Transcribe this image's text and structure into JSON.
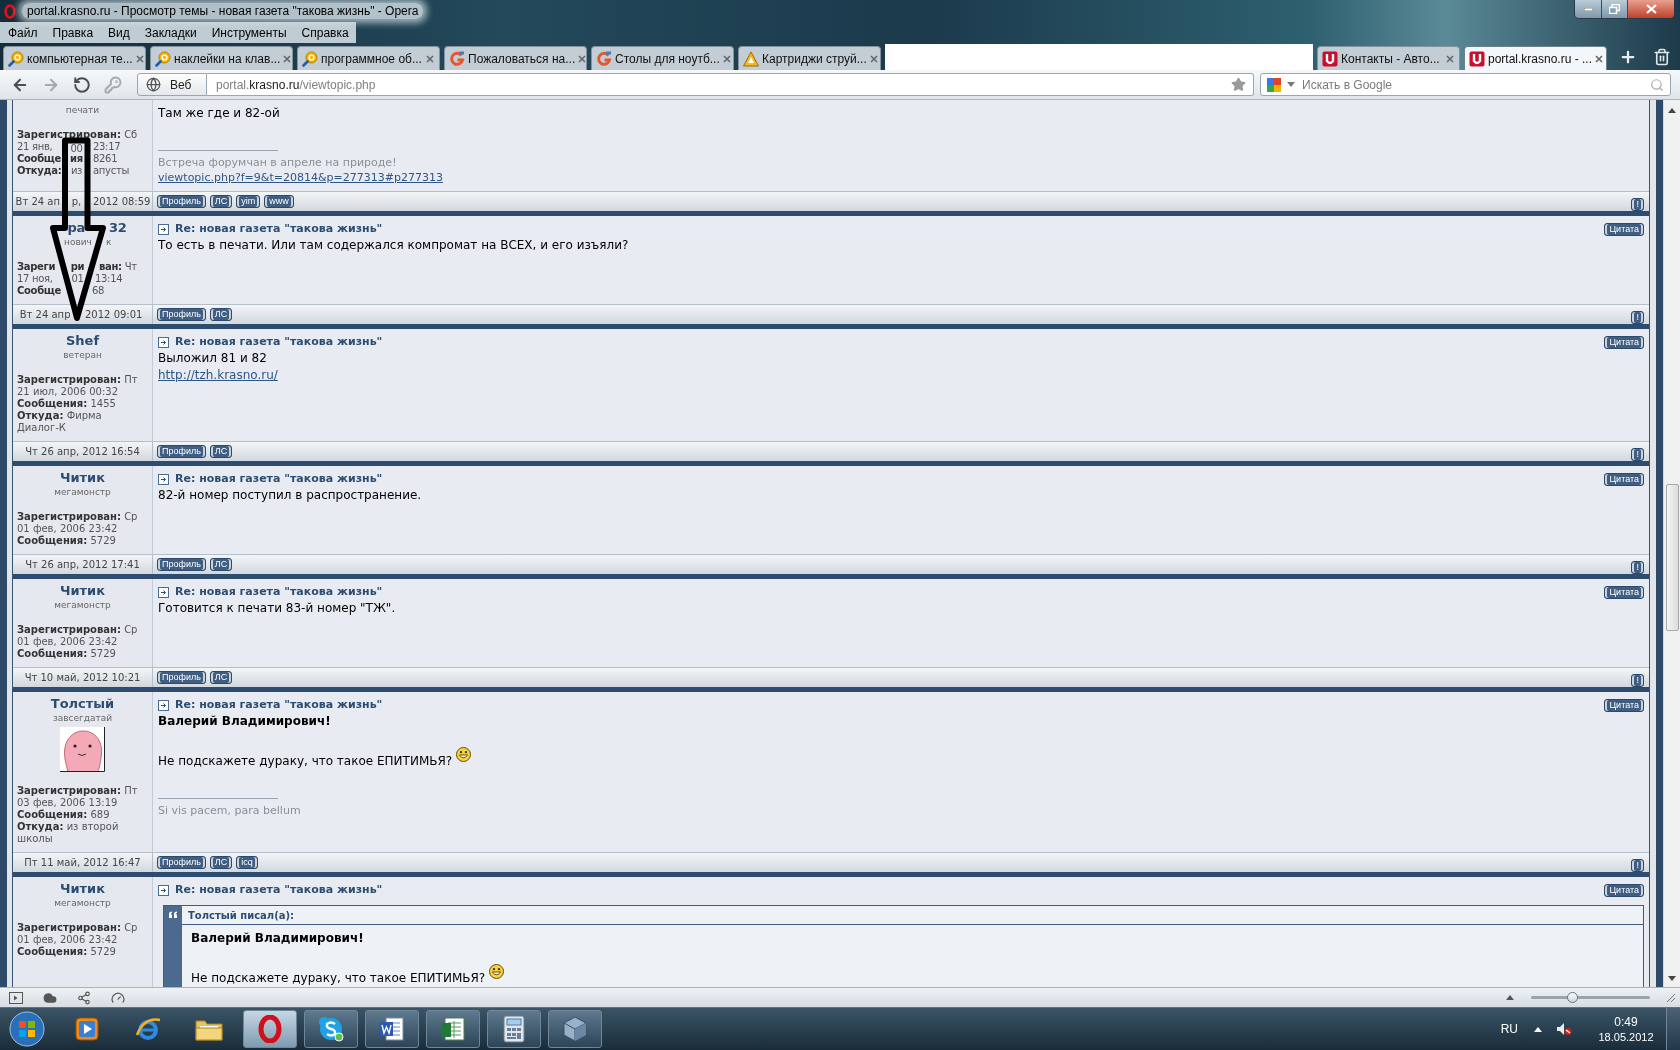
{
  "window": {
    "title": "portal.krasno.ru - Просмотр темы - новая газета \"такова жизнь\" - Opera"
  },
  "menu": [
    "Файл",
    "Правка",
    "Вид",
    "Закладки",
    "Инструменты",
    "Справка"
  ],
  "tabs": [
    {
      "kind": "magnifier",
      "label": "компьютерная те...",
      "selected": false
    },
    {
      "kind": "magnifier",
      "label": "наклейки на клав...",
      "selected": false
    },
    {
      "kind": "magnifier",
      "label": "программное об...",
      "selected": false
    },
    {
      "kind": "gletter",
      "label": "Пожаловаться на...",
      "selected": false
    },
    {
      "kind": "gletter",
      "label": "Столы для ноутб...",
      "selected": false
    },
    {
      "kind": "triangle",
      "label": "Картриджи струй...",
      "selected": false
    },
    {
      "kind": "cover"
    },
    {
      "kind": "square",
      "label": "Контакты - Авто...",
      "selected": false
    },
    {
      "kind": "square",
      "label": "portal.krasno.ru - ...",
      "selected": true
    }
  ],
  "nav": {
    "buttons": [
      {
        "kind": "back",
        "disabled": false
      },
      {
        "kind": "forward",
        "disabled": true
      },
      {
        "kind": "reload",
        "disabled": false
      },
      {
        "kind": "key",
        "disabled": true
      }
    ],
    "site_button": "Веб",
    "url": {
      "prefix": "portal.",
      "domain": "krasno.ru",
      "path": "/viewtopic.php"
    },
    "search": {
      "placeholder": "Искать в Google"
    }
  },
  "posts": [
    {
      "rank": "печати",
      "details": [
        {
          "kind": "plain",
          "label": "Зарегистрирован:",
          "value": "Сб"
        },
        {
          "kind": "split",
          "left": [
            {
              "text": "21 янв,",
              "bold": false
            }
          ],
          "middle": [
            {
              "text": "00",
              "bold": false
            }
          ],
          "right": [
            {
              "text": "23:17",
              "bold": false
            }
          ]
        },
        {
          "kind": "split",
          "left": [
            {
              "text": "Сообще",
              "bold": true
            }
          ],
          "middle": [
            {
              "text": "ия",
              "bold": true
            }
          ],
          "right": [
            {
              "text": "8261",
              "bold": false
            }
          ]
        },
        {
          "kind": "split",
          "left": [
            {
              "text": "Откуда:",
              "bold": true
            }
          ],
          "middle": [
            {
              "text": "из",
              "bold": false
            }
          ],
          "right": [
            {
              "text": "апусты",
              "bold": false
            }
          ]
        }
      ],
      "body": [
        {
          "kind": "text",
          "text": "Там же где и 82-ой"
        }
      ],
      "signature": [
        {
          "kind": "text",
          "text": "Встреча форумчан в апреле на природе!"
        },
        {
          "kind": "link",
          "text": "viewtopic.php?f=9&t=20814&p=277313#p277313"
        }
      ],
      "date_parts": {
        "left": [
          {
            "text": "Вт 24 ап"
          }
        ],
        "middle": [
          {
            "text": "р,"
          }
        ],
        "right": [
          {
            "text": "2012 08:59"
          }
        ]
      },
      "buttons": [
        "Профиль",
        "ЛС",
        "yim",
        "www"
      ],
      "report": "!"
    },
    {
      "author_parts": {
        "middle": [
          {
            "text": "ра"
          }
        ],
        "right": [
          {
            "text": "32"
          }
        ]
      },
      "rank_parts": {
        "middle": [
          {
            "text": "нович"
          }
        ],
        "right": [
          {
            "text": "к"
          }
        ]
      },
      "details": [
        {
          "kind": "split",
          "left": [
            {
              "text": "Зареги",
              "bold": true
            }
          ],
          "middle": [
            {
              "text": "ри",
              "bold": true
            }
          ],
          "right": [
            {
              "text": "ван:",
              "bold": true
            },
            {
              "text": "Чт",
              "bold": false
            }
          ]
        },
        {
          "kind": "split",
          "left": [
            {
              "text": "17 ноя,",
              "bold": false
            }
          ],
          "middle": [
            {
              "text": "01",
              "bold": false
            }
          ],
          "right": [
            {
              "text": "13:14",
              "bold": false
            }
          ]
        },
        {
          "kind": "split",
          "left": [
            {
              "text": "Сообще",
              "bold": true
            }
          ],
          "right": [
            {
              "text": "68",
              "bold": false
            }
          ]
        }
      ],
      "title": "Re: новая газета \"такова жизнь\"",
      "quote": "Цитата",
      "body": [
        {
          "kind": "text",
          "text": "То есть в печати. Или там содержался компромат на ВСЕХ, и его изъяли?"
        }
      ],
      "date_parts": {
        "left": [
          {
            "text": "Вт 24 апр"
          }
        ],
        "right": [
          {
            "text": "2012 09:01"
          }
        ]
      },
      "buttons": [
        "Профиль",
        "ЛС"
      ],
      "report": "!"
    },
    {
      "author": "Shef",
      "rank": "ветеран",
      "details": [
        {
          "kind": "plain",
          "label": "Зарегистрирован:",
          "value": "Пт 21 июл, 2006 00:32"
        },
        {
          "kind": "plain",
          "label": "Сообщения:",
          "value": "1455"
        },
        {
          "kind": "plain",
          "label": "Откуда:",
          "value": "Фирма Диалог-К"
        }
      ],
      "title": "Re: новая газета \"такова жизнь\"",
      "quote": "Цитата",
      "body": [
        {
          "kind": "text",
          "text": "Выложил 81 и 82"
        },
        {
          "kind": "link",
          "text": "http://tzh.krasno.ru/"
        }
      ],
      "date": "Чт 26 апр, 2012 16:54",
      "buttons": [
        "Профиль",
        "ЛС"
      ],
      "report": "!"
    },
    {
      "author": "Читик",
      "rank": "мегамонстр",
      "details": [
        {
          "kind": "plain",
          "label": "Зарегистрирован:",
          "value": "Ср 01 фев, 2006 23:42"
        },
        {
          "kind": "plain",
          "label": "Сообщения:",
          "value": "5729"
        }
      ],
      "title": "Re: новая газета \"такова жизнь\"",
      "quote": "Цитата",
      "body": [
        {
          "kind": "text",
          "text": "82-й номер поступил в распространение."
        }
      ],
      "date": "Чт 26 апр, 2012 17:41",
      "buttons": [
        "Профиль",
        "ЛС"
      ],
      "report": "!"
    },
    {
      "author": "Читик",
      "rank": "мегамонстр",
      "details": [
        {
          "kind": "plain",
          "label": "Зарегистрирован:",
          "value": "Ср 01 фев, 2006 23:42"
        },
        {
          "kind": "plain",
          "label": "Сообщения:",
          "value": "5729"
        }
      ],
      "title": "Re: новая газета \"такова жизнь\"",
      "quote": "Цитата",
      "body": [
        {
          "kind": "text",
          "text": "Готовится к печати 83-й номер \"ТЖ\"."
        }
      ],
      "date": "Чт 10 май, 2012 10:21",
      "buttons": [
        "Профиль",
        "ЛС"
      ],
      "report": "!"
    },
    {
      "author": "Толстый",
      "rank": "завсегдатай",
      "avatar": true,
      "details": [
        {
          "kind": "plain",
          "label": "Зарегистрирован:",
          "value": "Пт 03 фев, 2006 13:19"
        },
        {
          "kind": "plain",
          "label": "Сообщения:",
          "value": "689"
        },
        {
          "kind": "plain",
          "label": "Откуда:",
          "value": "из второй школы"
        }
      ],
      "title": "Re: новая газета \"такова жизнь\"",
      "quote": "Цитата",
      "body": [
        {
          "kind": "bold",
          "text": "Валерий Владимирович!"
        },
        {
          "kind": "text",
          "text": "Не подскажете дураку, что такое ЕПИТИМЬЯ?",
          "smiley": true
        }
      ],
      "signature": [
        {
          "kind": "text",
          "text": "Si vis pacem, para bellum"
        }
      ],
      "date": "Пт 11 май, 2012 16:47",
      "buttons": [
        "Профиль",
        "ЛС",
        "icq"
      ],
      "report": "!"
    },
    {
      "author": "Читик",
      "rank": "мегамонстр",
      "details": [
        {
          "kind": "plain",
          "label": "Зарегистрирован:",
          "value": "Ср 01 фев, 2006 23:42"
        },
        {
          "kind": "plain",
          "label": "Сообщения:",
          "value": "5729"
        }
      ],
      "title": "Re: новая газета \"такова жизнь\"",
      "quote": "Цитата",
      "body": [
        {
          "kind": "quote",
          "author": "Толстый писал(а):",
          "body": [
            {
              "kind": "bold",
              "text": "Валерий Владимирович!"
            },
            {
              "kind": "text",
              "text": "Не подскажете дураку, что такое ЕПИТИМЬЯ?",
              "smiley": true
            }
          ]
        }
      ]
    }
  ],
  "status_bar": {
    "zoom": {
      "level": 0.34
    }
  },
  "taskbar": {
    "apps": [
      {
        "kind": "media",
        "running": false,
        "selected": false
      },
      {
        "kind": "browser",
        "running": false,
        "selected": false
      },
      {
        "kind": "folder",
        "running": false,
        "selected": false
      },
      {
        "kind": "opera",
        "running": true,
        "selected": true
      },
      {
        "kind": "chat",
        "running": true,
        "selected": false
      },
      {
        "kind": "word",
        "running": true,
        "selected": false
      },
      {
        "kind": "sheet",
        "running": true,
        "selected": false
      },
      {
        "kind": "calculator",
        "running": true,
        "selected": false
      },
      {
        "kind": "cube",
        "running": true,
        "selected": false
      }
    ],
    "language": "RU",
    "time": "0:49",
    "date": "18.05.2012"
  }
}
